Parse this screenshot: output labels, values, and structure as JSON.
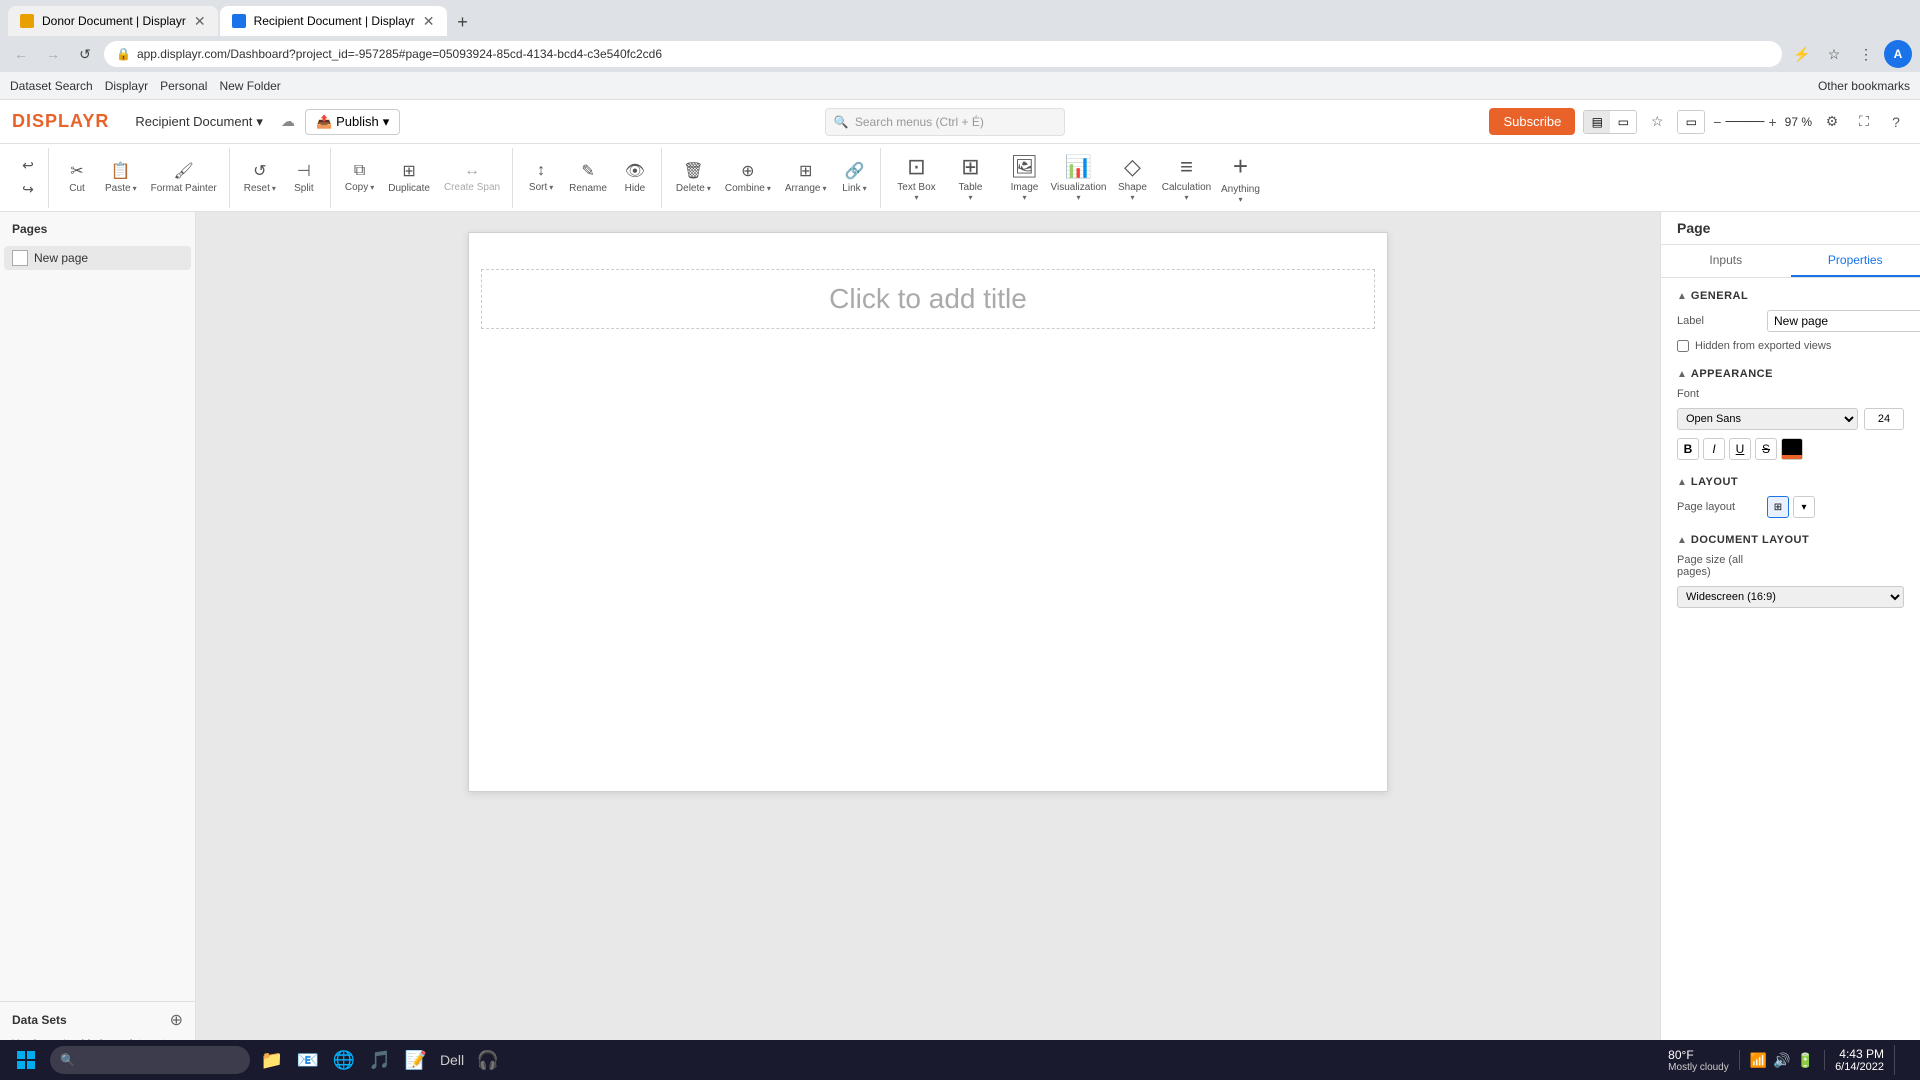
{
  "browser": {
    "tabs": [
      {
        "id": "tab1",
        "title": "Donor Document | Displayr",
        "active": false,
        "favicon_color": "#e8a000"
      },
      {
        "id": "tab2",
        "title": "Recipient Document | Displayr",
        "active": true,
        "favicon_color": "#1a73e8"
      }
    ],
    "url": "app.displayr.com/Dashboard?project_id=-957285#page=05093924-85cd-4134-bcd4-c3e540fc2cd6",
    "profile_initial": "A"
  },
  "bookmarks": [
    {
      "label": "Dataset Search"
    },
    {
      "label": "Displayr"
    },
    {
      "label": "Personal"
    },
    {
      "label": "New Folder"
    },
    {
      "label": "Other bookmarks"
    }
  ],
  "header": {
    "logo": "DISPLAYR",
    "doc_title": "Recipient Document",
    "cloud_icon": "☁",
    "publish_label": "Publish",
    "search_placeholder": "Search menus (Ctrl + É)",
    "subscribe_label": "Subscribe",
    "zoom_level": "97 %"
  },
  "toolbar": {
    "undo_label": "↩",
    "redo_label": "↪",
    "cut_label": "Cut",
    "paste_label": "Paste",
    "format_painter_label": "Format Painter",
    "reset_label": "Reset",
    "split_label": "Split",
    "copy_label": "Copy",
    "duplicate_label": "Duplicate",
    "create_span_label": "Create Span",
    "sort_label": "Sort",
    "rename_label": "Rename",
    "hide_label": "Hide",
    "delete_label": "Delete",
    "combine_label": "Combine",
    "arrange_label": "Arrange",
    "link_label": "Link",
    "insert_items": [
      {
        "id": "textbox",
        "label": "Text Box",
        "icon": "⊡"
      },
      {
        "id": "table",
        "label": "Table",
        "icon": "⊞"
      },
      {
        "id": "image",
        "label": "Image",
        "icon": "🖼"
      },
      {
        "id": "visualization",
        "label": "Visualization",
        "icon": "📊"
      },
      {
        "id": "shape",
        "label": "Shape",
        "icon": "◇"
      },
      {
        "id": "calculation",
        "label": "Calculation",
        "icon": "≡"
      },
      {
        "id": "anything",
        "label": "Anything",
        "icon": "+"
      }
    ]
  },
  "left_panel": {
    "pages_title": "Pages",
    "pages": [
      {
        "id": "page1",
        "label": "New page"
      }
    ],
    "datasets_title": "Data Sets",
    "datasets_empty": "You haven't added any data sets.",
    "add_dataset_label": "Add a data set"
  },
  "canvas": {
    "title_placeholder": "Click to add title"
  },
  "right_panel": {
    "title": "Page",
    "tabs": [
      "Inputs",
      "Properties"
    ],
    "active_tab": "Properties",
    "sections": {
      "general": {
        "title": "GENERAL",
        "label_field_label": "Label",
        "label_field_value": "New page",
        "hidden_checkbox_label": "Hidden from exported views"
      },
      "appearance": {
        "title": "APPEARANCE",
        "font_label": "Font",
        "font_value": "Open Sans",
        "font_size": "24",
        "bold": "B",
        "italic": "I",
        "underline": "U",
        "strikethrough": "S"
      },
      "layout": {
        "title": "LAYOUT",
        "page_layout_label": "Page layout"
      },
      "document_layout": {
        "title": "DOCUMENT LAYOUT",
        "page_size_label": "Page size (all pages)",
        "page_size_value": "Widescreen (16:9)"
      }
    }
  },
  "taskbar": {
    "weather_temp": "80°F",
    "weather_desc": "Mostly cloudy",
    "time": "4:43 PM",
    "date": "6/14/2022",
    "apps": [
      "⊞",
      "🔍",
      "📁",
      "📦",
      "🌐",
      "🎵",
      "📋",
      "✉",
      "📝",
      "🖥"
    ]
  }
}
